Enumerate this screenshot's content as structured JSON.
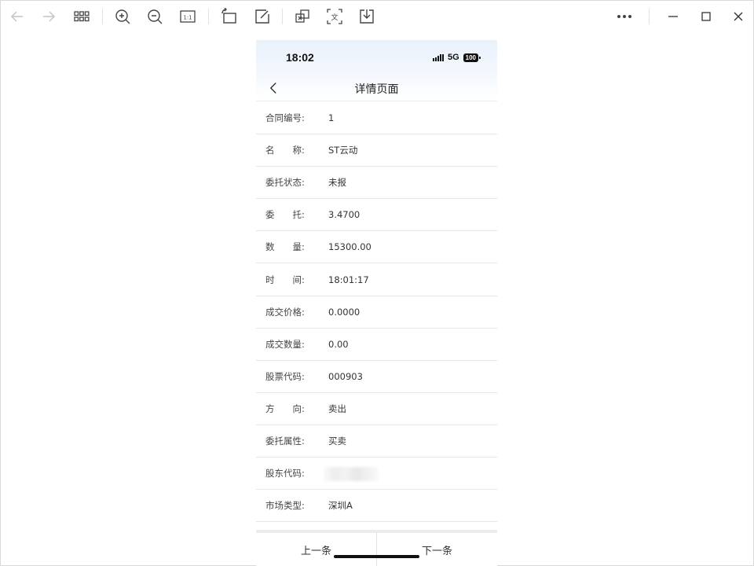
{
  "toolbar": {
    "buttons": [
      {
        "name": "back-arrow-icon"
      },
      {
        "name": "forward-arrow-icon"
      },
      {
        "name": "grid-view-icon"
      },
      {
        "name": "zoom-in-icon"
      },
      {
        "name": "zoom-out-icon"
      },
      {
        "name": "actual-size-icon"
      },
      {
        "name": "rotate-icon"
      },
      {
        "name": "edit-icon"
      },
      {
        "name": "image-translate-icon"
      },
      {
        "name": "text-recognize-icon"
      },
      {
        "name": "download-icon"
      },
      {
        "name": "more-icon"
      },
      {
        "name": "minimize-icon"
      },
      {
        "name": "maximize-icon"
      },
      {
        "name": "close-icon"
      }
    ],
    "actual_size_label": "1:1",
    "text_recognize_label": "文"
  },
  "phone": {
    "status_bar": {
      "time": "18:02",
      "network": "5G",
      "battery": "100"
    },
    "nav": {
      "title": "详情页面"
    },
    "rows": [
      {
        "label": "合同编号:",
        "value": "1"
      },
      {
        "label": "名　　称:",
        "value": "ST云动"
      },
      {
        "label": "委托状态:",
        "value": "未报"
      },
      {
        "label": "委　　托:",
        "value": "3.4700"
      },
      {
        "label": "数　　量:",
        "value": "15300.00"
      },
      {
        "label": "时　　间:",
        "value": "18:01:17"
      },
      {
        "label": "成交价格:",
        "value": "0.0000"
      },
      {
        "label": "成交数量:",
        "value": "0.00"
      },
      {
        "label": "股票代码:",
        "value": "000903"
      },
      {
        "label": "方　　向:",
        "value": "卖出"
      },
      {
        "label": "委托属性:",
        "value": "买卖"
      },
      {
        "label": "股东代码:",
        "value": ""
      },
      {
        "label": "市场类型:",
        "value": "深圳A"
      }
    ],
    "footer": {
      "prev_label": "上一条",
      "next_label": "下一条"
    }
  }
}
